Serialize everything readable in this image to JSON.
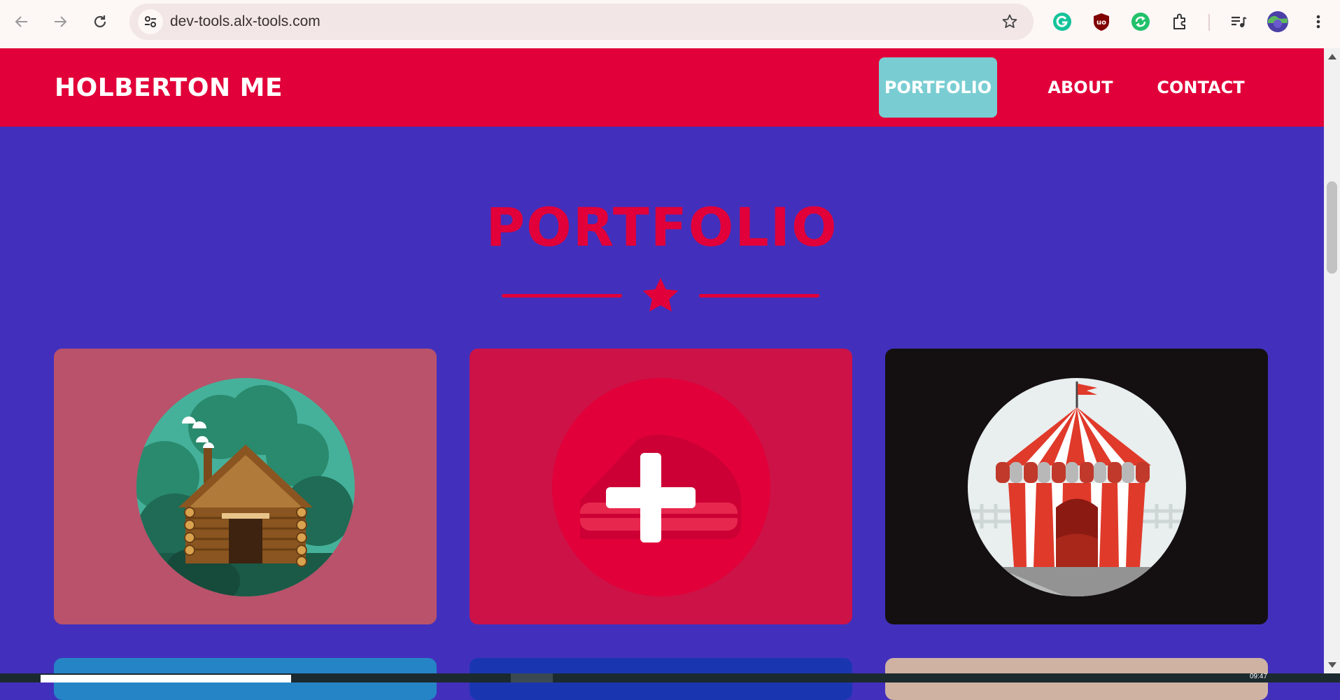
{
  "browser": {
    "url": "dev-tools.alx-tools.com",
    "extensions": [
      "grammarly-icon",
      "ublock-icon",
      "sync-icon",
      "puzzle-extensions-icon",
      "media-queue-icon",
      "profile-avatar"
    ]
  },
  "header": {
    "brand": "HOLBERTON ME",
    "nav": [
      {
        "label": "PORTFOLIO",
        "active": true
      },
      {
        "label": "ABOUT",
        "active": false
      },
      {
        "label": "CONTACT",
        "active": false
      }
    ]
  },
  "portfolio": {
    "title": "PORTFOLIO",
    "cards": [
      {
        "name": "cabin",
        "bg": "#b9526a"
      },
      {
        "name": "cake",
        "bg": "#cd1248"
      },
      {
        "name": "circus",
        "bg": "#141011"
      },
      {
        "name": "card-4",
        "bg": "#2584c5"
      },
      {
        "name": "card-5",
        "bg": "#1936b0"
      },
      {
        "name": "card-6",
        "bg": "#cfb2a2"
      }
    ]
  },
  "colors": {
    "primary": "#e10039",
    "background": "#4230bd",
    "accent": "#79cdd2"
  },
  "taskbar": {
    "time": "09:47"
  }
}
